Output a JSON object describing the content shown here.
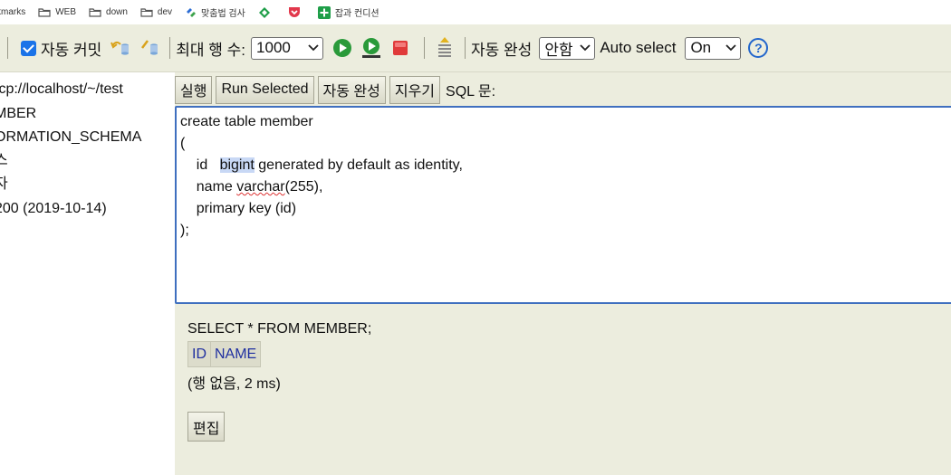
{
  "bookmarks": [
    {
      "label": "kmarks",
      "icon": "none"
    },
    {
      "label": "WEB",
      "icon": "folder-icon"
    },
    {
      "label": "down",
      "icon": "folder-icon"
    },
    {
      "label": "dev",
      "icon": "folder-icon"
    },
    {
      "label": "맞춤법 검사",
      "icon": "spellcheck-icon"
    },
    {
      "label": "",
      "icon": "green-diamond-icon"
    },
    {
      "label": "",
      "icon": "pocket-icon"
    },
    {
      "label": "잡과 컨디션",
      "icon": "green-cross-icon"
    }
  ],
  "toolbar": {
    "autocommit_label": "자동 커밋",
    "autocommit_checked": true,
    "max_rows_label": "최대 행 수:",
    "max_rows_value": "1000",
    "autocomplete_label": "자동 완성",
    "autocomplete_value": "안함",
    "auto_select_label": "Auto select",
    "auto_select_value": "On",
    "help_label": "?"
  },
  "tree": {
    "items": [
      "tcp://localhost/~/test",
      "MBER",
      "ORMATION_SCHEMA",
      "스",
      "자",
      "200 (2019-10-14)"
    ]
  },
  "query_bar": {
    "run_label": "실행",
    "run_selected_label": "Run Selected",
    "autocomplete_label": "자동 완성",
    "clear_label": "지우기",
    "sql_label": "SQL 문:"
  },
  "editor": {
    "line1": "create table member",
    "line2": "(",
    "line3_indent": "    id   ",
    "line3_highlight": "bigint",
    "line3_rest": " generated by default as identity,",
    "line4_indent": "    name ",
    "line4_squiggle": "varchar",
    "line4_rest": "(255),",
    "line5": "    primary key (id)",
    "line6": ");"
  },
  "result": {
    "sql": "SELECT * FROM MEMBER;",
    "columns": [
      "ID",
      "NAME"
    ],
    "status": "(행 없음, 2 ms)",
    "edit_label": "편집"
  },
  "colors": {
    "panel_bg": "#ecedde",
    "editor_border": "#3f6fbf",
    "column_header_text": "#1f2fa0",
    "checkbox": "#1a73e8"
  }
}
